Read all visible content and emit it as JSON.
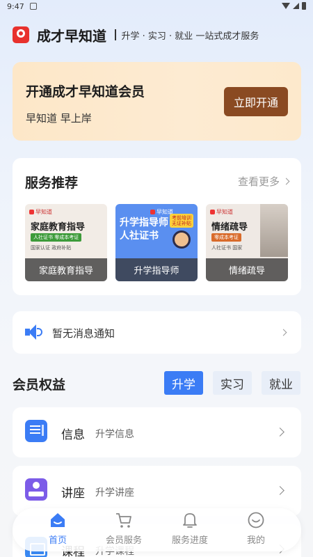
{
  "status_bar": {
    "time": "9:47"
  },
  "header": {
    "app_name": "成才早知道",
    "slogan": "升学 · 实习 · 就业  一站式成才服务"
  },
  "member_banner": {
    "title": "开通成才早知道会员",
    "subtitle": "早知道 早上岸",
    "button": "立即开通",
    "button_color": "#8a4a22"
  },
  "services": {
    "title": "服务推荐",
    "more": "查看更多",
    "items": [
      {
        "caption": "家庭教育指导",
        "poster_title": "家庭教育指导",
        "poster_tag": "人社证书  零成本考证",
        "poster_text": "国家认证  政府补贴",
        "poster_brand": "早知道"
      },
      {
        "caption": "升学指导师",
        "poster_title": "升学指导师\n人社证书",
        "poster_badge": "考前培训\n无证补贴",
        "poster_brand": "早知道"
      },
      {
        "caption": "情绪疏导",
        "poster_title": "情绪疏导",
        "poster_tag": "零成本考证",
        "poster_text": "人社证书  国家",
        "poster_brand": "早知道"
      }
    ]
  },
  "notice": {
    "text": "暂无消息通知"
  },
  "rights": {
    "title": "会员权益",
    "tabs": [
      "升学",
      "实习",
      "就业"
    ],
    "active_tab": "升学",
    "items": [
      {
        "name": "信息",
        "desc": "升学信息",
        "icon": "newspaper-icon"
      },
      {
        "name": "讲座",
        "desc": "升学讲座",
        "icon": "lecture-icon"
      },
      {
        "name": "课程",
        "desc": "升学课程",
        "icon": "course-icon"
      }
    ]
  },
  "bottom_nav": [
    {
      "label": "首页",
      "icon": "home-icon",
      "active": true
    },
    {
      "label": "会员服务",
      "icon": "cart-icon",
      "active": false
    },
    {
      "label": "服务进度",
      "icon": "bell-icon",
      "active": false
    },
    {
      "label": "我的",
      "icon": "smile-icon",
      "active": false
    }
  ],
  "colors": {
    "accent": "#3b7cf5",
    "banner_bg": "#fde7c8"
  }
}
